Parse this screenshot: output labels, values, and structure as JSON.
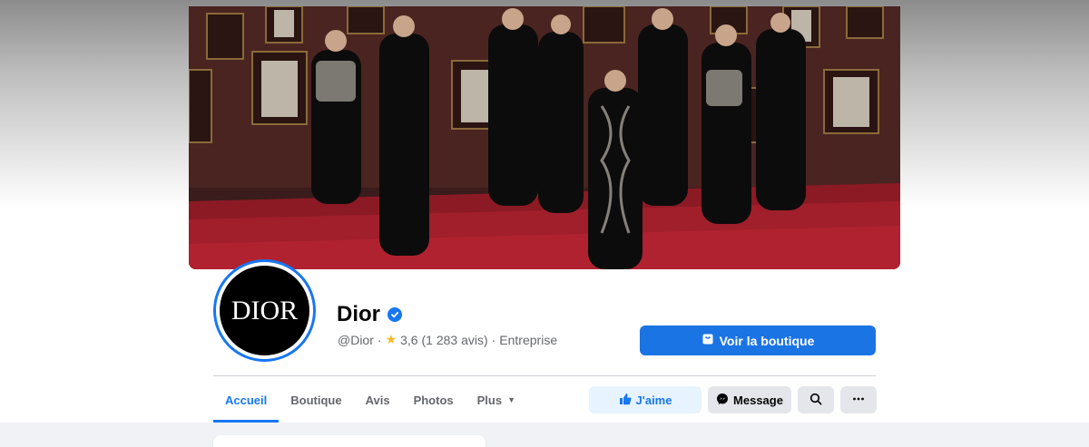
{
  "page": {
    "name": "Dior",
    "avatar_text": "DIOR",
    "handle": "@Dior",
    "separator": "·",
    "rating": "3,6 (1 283 avis)",
    "category": "Entreprise"
  },
  "buttons": {
    "shop": "Voir la boutique",
    "like": "J'aime",
    "message": "Message"
  },
  "tabs": [
    {
      "label": "Accueil",
      "active": true
    },
    {
      "label": "Boutique",
      "active": false
    },
    {
      "label": "Avis",
      "active": false
    },
    {
      "label": "Photos",
      "active": false
    },
    {
      "label": "Plus",
      "active": false
    }
  ],
  "icons": {
    "verified": "verified-check-icon",
    "star": "star-icon",
    "shop": "shopping-bag-icon",
    "like": "thumbs-up-icon",
    "message": "messenger-icon",
    "search": "search-icon",
    "more": "more-horizontal-icon",
    "caret": "caret-down-icon"
  },
  "colors": {
    "accent": "#1877f2",
    "shop_button": "#1b74e4",
    "like_bg": "#e7f3ff",
    "secondary_bg": "#e4e6eb",
    "muted_text": "#65676b",
    "star": "#f7b928"
  }
}
